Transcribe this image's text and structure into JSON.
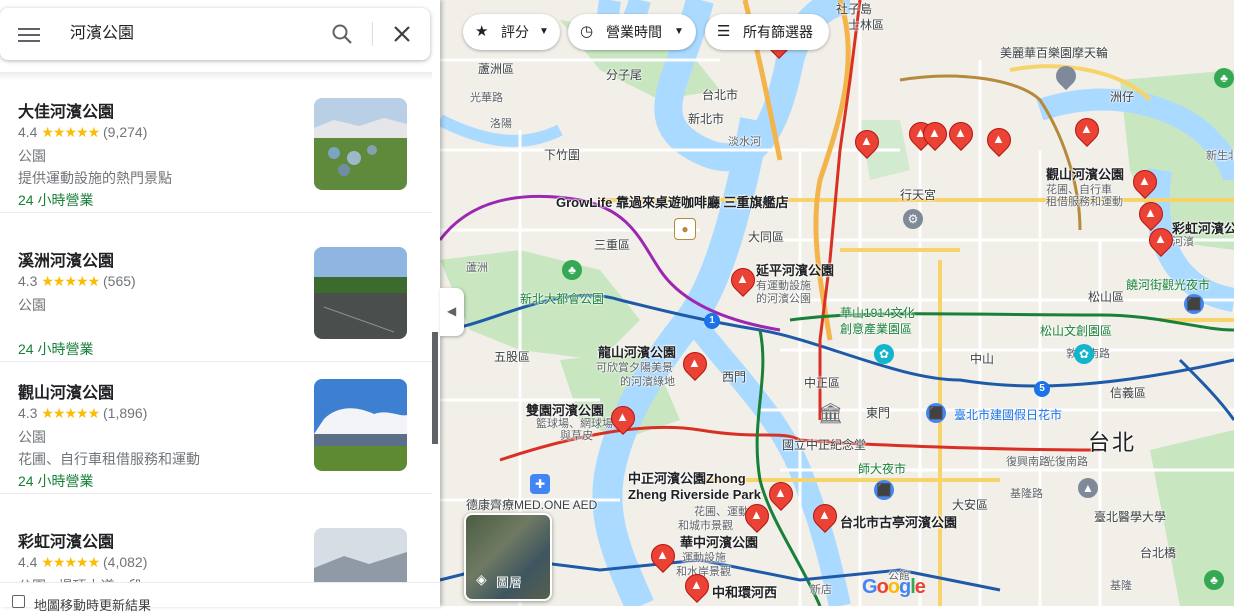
{
  "search": {
    "query": "河濱公園"
  },
  "results": [
    {
      "name": "大佳河濱公園",
      "rating": "4.4",
      "stars": "★★★★★",
      "reviews": "(9,274)",
      "type": "公園",
      "desc": "提供運動設施的熱門景點",
      "hours": "24 小時營業"
    },
    {
      "name": "溪洲河濱公園",
      "rating": "4.3",
      "stars": "★★★★★",
      "reviews": "(565)",
      "type": "公園",
      "desc": "",
      "hours": "24 小時營業"
    },
    {
      "name": "觀山河濱公園",
      "rating": "4.3",
      "stars": "★★★★★",
      "reviews": "(1,896)",
      "type": "公園",
      "desc": "花圃、自行車租借服務和運動",
      "hours": "24 小時營業"
    },
    {
      "name": "彩虹河濱公園",
      "rating": "4.4",
      "stars": "★★★★★",
      "reviews": "(4,082)",
      "type": "公園 · 堤頂大道一段",
      "desc": "",
      "hours": ""
    }
  ],
  "bottom": {
    "update_label": "地圖移動時更新結果"
  },
  "filters": {
    "rating": "評分",
    "hours": "營業時間",
    "all": "所有篩選器"
  },
  "layers": {
    "label": "圖層"
  },
  "logo": "Google",
  "colors": {
    "accent": "#1a73e8",
    "pin": "#ea4335",
    "open": "#188038",
    "star": "#fbbc04"
  },
  "map": {
    "labels": [
      "社子島",
      "士林區",
      "美麗華百樂園摩天輪",
      "蘆洲區",
      "分子尾",
      "台北市",
      "新北市",
      "洲仔",
      "光華路",
      "洛陽",
      "淡水河",
      "下竹圍",
      "大同區",
      "三重區",
      "GrowLife 靠過來桌遊咖啡廳 三重旗艦店",
      "行天宮",
      "觀山河濱公園",
      "花圃、自行車",
      "租借服務和運動",
      "彩虹河濱公園",
      "河濱",
      "饒河街觀光夜市",
      "延平河濱公園",
      "有運動設施",
      "的河濱公園",
      "新北大都會公園",
      "松山區",
      "松山文創園區",
      "華山1914文化",
      "創意產業園區",
      "五股區",
      "蘆洲",
      "龍山河濱公園",
      "可欣賞夕陽美景",
      "的河濱綠地",
      "西門",
      "中正區",
      "中山",
      "信義區",
      "雙園河濱公園",
      "籃球場、網球場",
      "與草皮",
      "國立中正紀念堂",
      "東門",
      "臺北市建國假日花市",
      "台北",
      "師大夜市",
      "大安區",
      "臺北醫學大學",
      "中正河濱公園Zhong",
      "Zheng Riverside Park",
      "花圃、運動場",
      "和城市景觀",
      "德康齊療MED.ONE AED",
      "華中河濱公園",
      "運動設施",
      "和水岸景觀",
      "台北市古亭河濱公園",
      "中和環河西",
      "光復南路",
      "基隆路",
      "復興南路",
      "敦化南路",
      "新生北路",
      "台北橋",
      "公館",
      "新店",
      "基隆"
    ]
  }
}
